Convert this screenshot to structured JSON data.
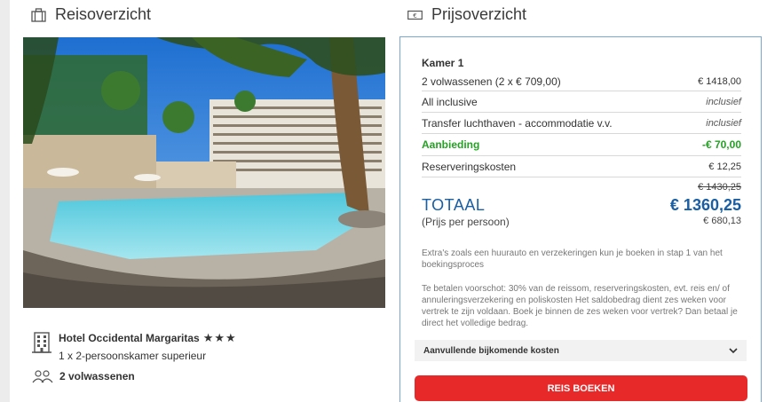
{
  "trip": {
    "heading": "Reisoverzicht",
    "heading_icon": "suitcase-icon",
    "hotel_name": "Hotel Occidental Margaritas",
    "star_rating": 3,
    "room_type": "1 x 2-persoonskamer superieur",
    "guests": "2 volwassenen",
    "photo": "hotel-pool-photo"
  },
  "price": {
    "heading": "Prijsoverzicht",
    "heading_icon": "banknote-icon",
    "room_label": "Kamer 1",
    "lines": [
      {
        "label": "2 volwassenen (2 x € 709,00)",
        "value": "€ 1418,00"
      },
      {
        "label": "All inclusive",
        "value": "inclusief"
      },
      {
        "label": "Transfer luchthaven - accommodatie v.v.",
        "value": "inclusief"
      },
      {
        "label": "Aanbieding",
        "value": "-€ 70,00"
      },
      {
        "label": "Reserveringskosten",
        "value": "€ 12,25"
      }
    ],
    "old_total": "€ 1430,25",
    "total_label": "TOTAAL",
    "total_amount": "€ 1360,25",
    "per_person_label": "(Prijs per persoon)",
    "per_person_amount": "€ 680,13",
    "note_extras": "Extra's zoals een huurauto en verzekeringen kun je boeken in stap 1 van het boekingsproces",
    "note_payment": "Te betalen voorschot: 30% van de reissom, reserveringskosten, evt. reis en/ of annuleringsverzekering en poliskosten Het saldobedrag dient zes weken voor vertrek te zijn voldaan. Boek je binnen de zes weken voor vertrek? Dan betaal je direct het volledige bedrag.",
    "extra_costs_label": "Aanvullende bijkomende kosten",
    "book_button": "REIS BOEKEN"
  },
  "colors": {
    "accent_blue": "#1a5ea3",
    "discount_green": "#23a223",
    "book_red": "#e8292a",
    "card_border": "#7aa6d6"
  }
}
